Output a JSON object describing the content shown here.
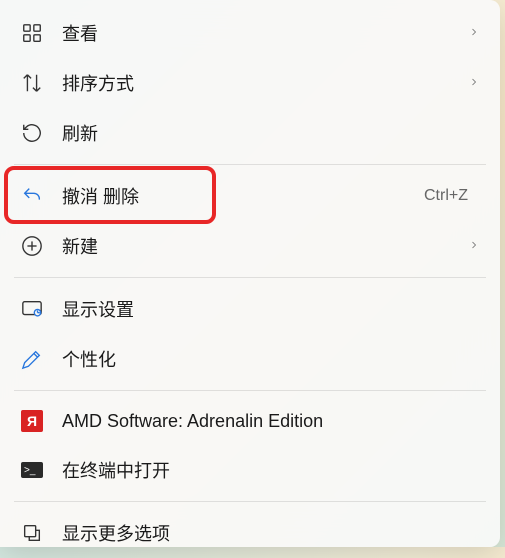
{
  "menu": {
    "view": {
      "label": "查看",
      "has_submenu": true
    },
    "sort": {
      "label": "排序方式",
      "has_submenu": true
    },
    "refresh": {
      "label": "刷新"
    },
    "undo": {
      "label": "撤消 删除",
      "shortcut": "Ctrl+Z"
    },
    "new": {
      "label": "新建",
      "has_submenu": true
    },
    "display_settings": {
      "label": "显示设置"
    },
    "personalize": {
      "label": "个性化"
    },
    "amd": {
      "label": "AMD Software: Adrenalin Edition"
    },
    "terminal": {
      "label": "在终端中打开"
    },
    "more_options": {
      "label": "显示更多选项"
    }
  },
  "icons": {
    "amd_label": "Я",
    "terminal_label": ">_"
  }
}
